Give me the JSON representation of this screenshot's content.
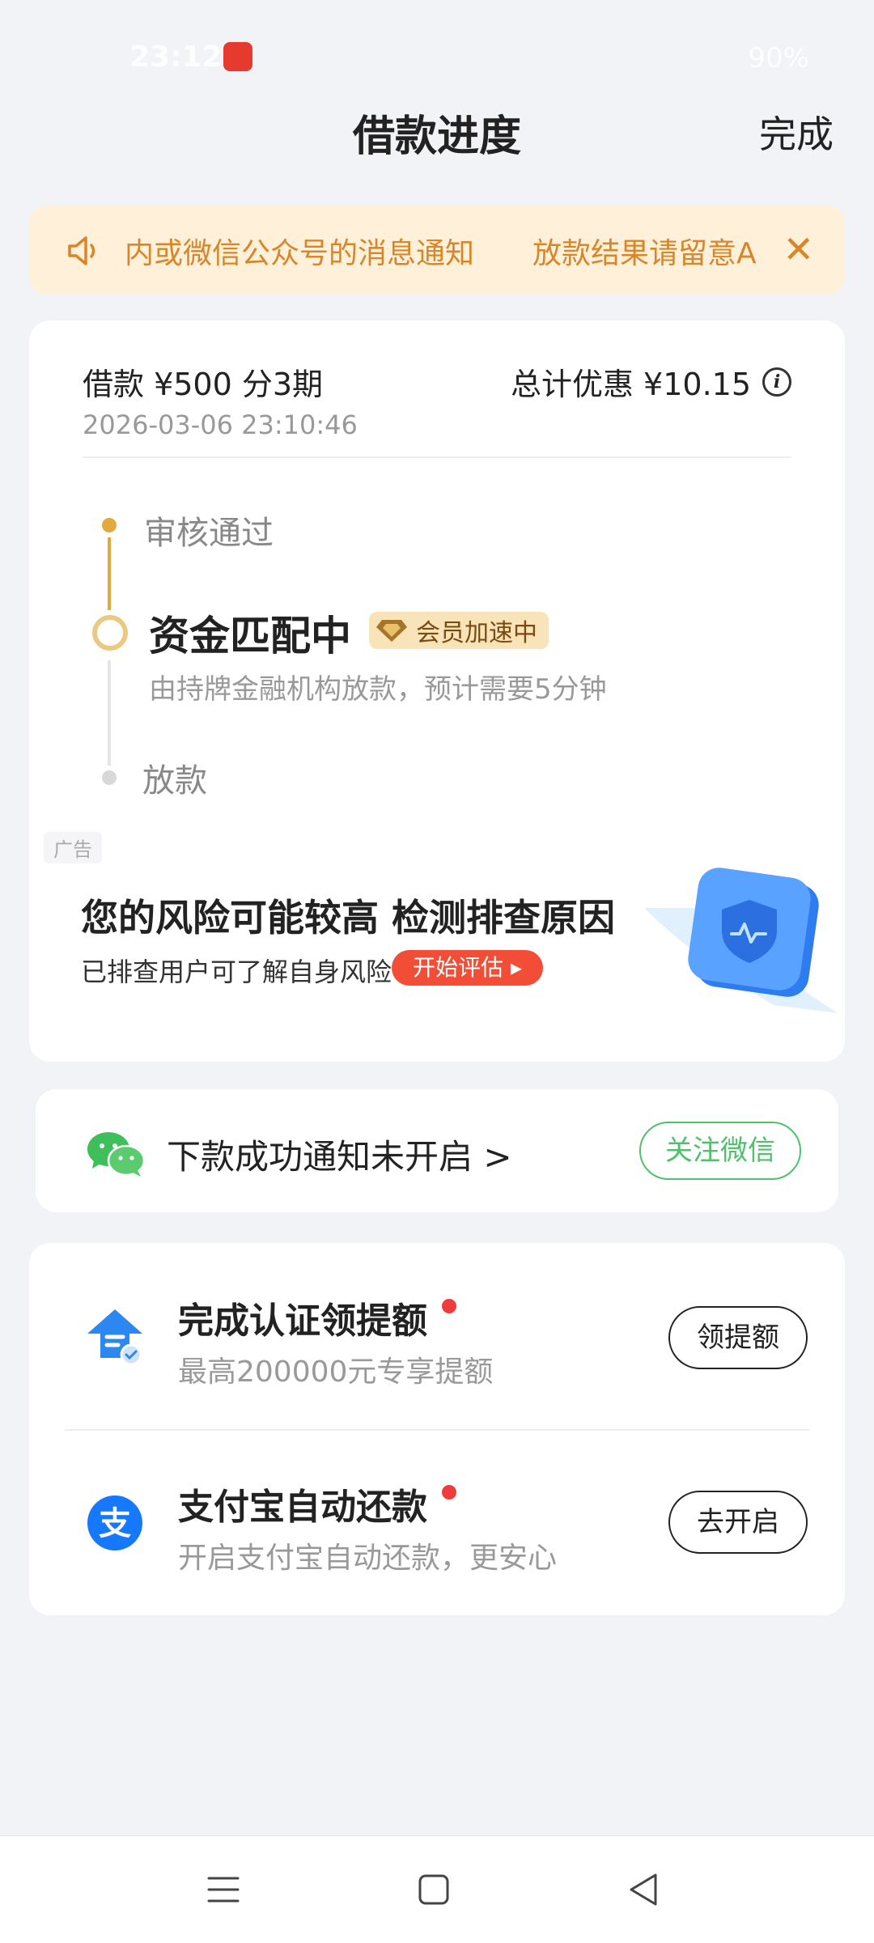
{
  "status_bar": {
    "time": "23:12",
    "battery": "90%"
  },
  "header": {
    "title": "借款进度",
    "done_label": "完成"
  },
  "notice": {
    "text": "内或微信公众号的消息通知　　放款结果请留意A"
  },
  "loan": {
    "summary": "借款 ¥500  分3期",
    "discount": "总计优惠 ¥10.15",
    "datetime": "2026-03-06 23:10:46"
  },
  "timeline": {
    "step1": "审核通过",
    "step2": "资金匹配中",
    "badge": "会员加速中",
    "step2_sub": "由持牌金融机构放款，预计需要5分钟",
    "step3": "放款"
  },
  "ad": {
    "tag": "广告",
    "title": "您的风险可能较高 检测排查原因",
    "subtitle": "已排查用户可了解自身风险",
    "button": "开始评估 ▸"
  },
  "wechat": {
    "text": "下款成功通知未开启 >",
    "button": "关注微信"
  },
  "tasks": [
    {
      "title": "完成认证领提额",
      "subtitle": "最高200000元专享提额",
      "button": "领提额"
    },
    {
      "title": "支付宝自动还款",
      "subtitle": "开启支付宝自动还款，更安心",
      "button": "去开启"
    }
  ],
  "colors": {
    "accent": "#e4a93c",
    "wechat_green": "#4fc16a",
    "notice_text": "#d9862a",
    "ad_button": "#f24d37"
  }
}
